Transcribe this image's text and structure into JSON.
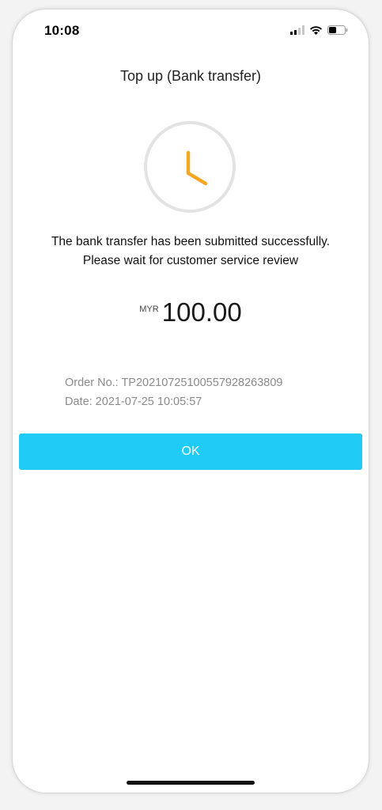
{
  "status_bar": {
    "time": "10:08",
    "icons": [
      "signal-icon",
      "wifi-icon",
      "battery-icon"
    ]
  },
  "header": {
    "title": "Top up (Bank transfer)"
  },
  "status_icon": "clock-icon",
  "message": {
    "line1": "The bank transfer has been submitted successfully.",
    "line2": "Please wait for customer service review"
  },
  "amount": {
    "currency": "MYR",
    "value": "100.00"
  },
  "order": {
    "order_no": "Order No.: TP20210725100557928263809",
    "date": "Date: 2021-07-25 10:05:57"
  },
  "actions": {
    "ok_label": "OK"
  },
  "colors": {
    "accent": "#20cbf6",
    "clock_hands": "#f5a623",
    "clock_ring": "#e3e3e3"
  }
}
